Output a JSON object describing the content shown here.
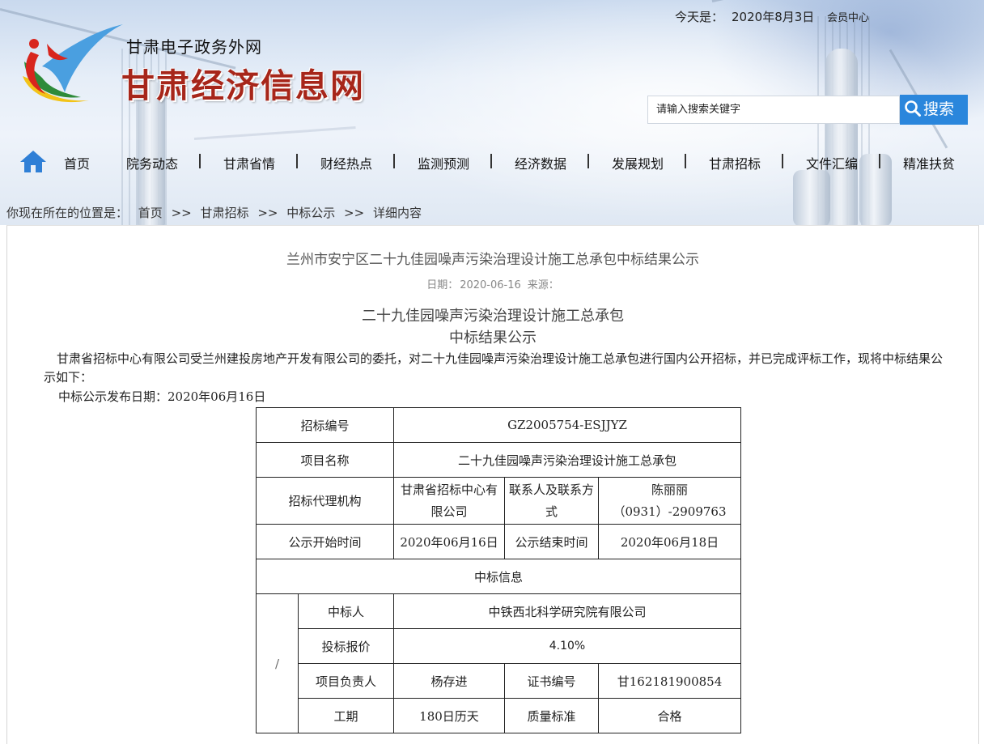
{
  "top": {
    "today_label": "今天是：",
    "today_date": "2020年8月3日",
    "member_center": "会员中心"
  },
  "logo": {
    "subtitle": "甘肃电子政务外网",
    "title": "甘肃经济信息网"
  },
  "search": {
    "placeholder": "请输入搜索关键字",
    "button_label": "搜索"
  },
  "nav": {
    "items": [
      "首页",
      "院务动态",
      "甘肃省情",
      "财经热点",
      "监测预测",
      "经济数据",
      "发展规划",
      "甘肃招标",
      "文件汇编",
      "精准扶贫"
    ]
  },
  "breadcrumb": {
    "prefix": "你现在所在的位置是：",
    "items": [
      "首页",
      "甘肃招标",
      "中标公示",
      "详细内容"
    ],
    "separator": ">>"
  },
  "article": {
    "title": "兰州市安宁区二十九佳园噪声污染治理设计施工总承包中标结果公示",
    "date_label": "日期：",
    "date": "2020-06-16",
    "source_label": "来源：",
    "heading_line1": "二十九佳园噪声污染治理设计施工总承包",
    "heading_line2": "中标结果公示",
    "intro": "甘肃省招标中心有限公司受兰州建投房地产开发有限公司的委托，对二十九佳园噪声污染治理设计施工总承包进行国内公开招标，并已完成评标工作，现将中标结果公示如下：",
    "publish_date": "中标公示发布日期：2020年06月16日"
  },
  "table": {
    "bid_no_label": "招标编号",
    "bid_no": "GZ2005754-ESJJYZ",
    "project_label": "项目名称",
    "project": "二十九佳园噪声污染治理设计施工总承包",
    "agency_label": "招标代理机构",
    "agency": "甘肃省招标中心有限公司",
    "contact_label": "联系人及联系方式",
    "contact_name": "陈丽丽",
    "contact_phone": "（0931）-2909763",
    "start_label": "公示开始时间",
    "start": "2020年06月16日",
    "end_label": "公示结束时间",
    "end": "2020年06月18日",
    "winner_info_label": "中标信息",
    "slash": "/",
    "winner_label": "中标人",
    "winner": "中铁西北科学研究院有限公司",
    "price_label": "投标报价",
    "price": "4.10%",
    "manager_label": "项目负责人",
    "manager": "杨存进",
    "cert_label": "证书编号",
    "cert": "甘162181900854",
    "duration_label": "工期",
    "duration": "180日历天",
    "quality_label": "质量标准",
    "quality": "合格"
  }
}
